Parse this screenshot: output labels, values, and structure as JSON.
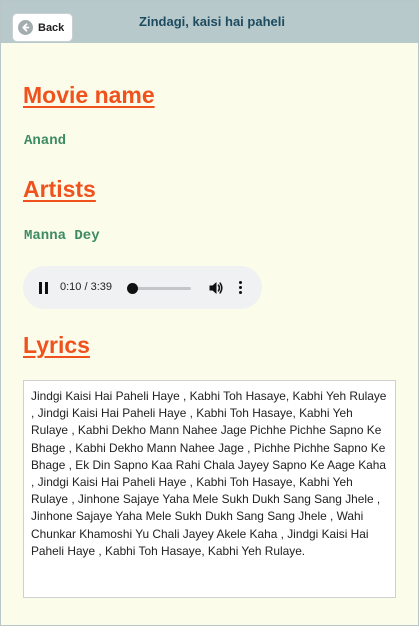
{
  "header": {
    "back_label": "Back",
    "title": "Zindagi, kaisi hai paheli"
  },
  "movie": {
    "heading": "Movie name",
    "value": "Anand"
  },
  "artists": {
    "heading": "Artists",
    "value": "Manna Dey"
  },
  "player": {
    "time": "0:10 / 3:39",
    "progress_fraction": 0.0457
  },
  "lyrics": {
    "heading": "Lyrics",
    "text": "Jindgi Kaisi Hai Paheli Haye , Kabhi Toh Hasaye, Kabhi Yeh Rulaye , Jindgi Kaisi Hai Paheli Haye , Kabhi Toh Hasaye, Kabhi Yeh Rulaye , Kabhi Dekho Mann Nahee Jage Pichhe Pichhe Sapno Ke Bhage , Kabhi Dekho Mann Nahee Jage , Pichhe Pichhe Sapno Ke Bhage , Ek Din Sapno Kaa Rahi Chala Jayey Sapno Ke Aage Kaha , Jindgi Kaisi Hai Paheli Haye , Kabhi Toh Hasaye, Kabhi Yeh Rulaye , Jinhone Sajaye Yaha Mele Sukh Dukh Sang Sang Jhele , Jinhone Sajaye Yaha Mele Sukh Dukh Sang Sang Jhele , Wahi Chunkar Khamoshi Yu Chali Jayey Akele Kaha , Jindgi Kaisi Hai Paheli Haye , Kabhi Toh Hasaye, Kabhi Yeh Rulaye."
  },
  "colors": {
    "background": "#fbfce9",
    "topbar": "#b8c9cb",
    "heading": "#f0521e",
    "value": "#3d8b63",
    "title": "#1d4b60"
  },
  "icons": {
    "back": "back-arrow-circle-icon",
    "pause": "pause-icon",
    "volume": "volume-icon",
    "more": "more-vertical-icon"
  }
}
